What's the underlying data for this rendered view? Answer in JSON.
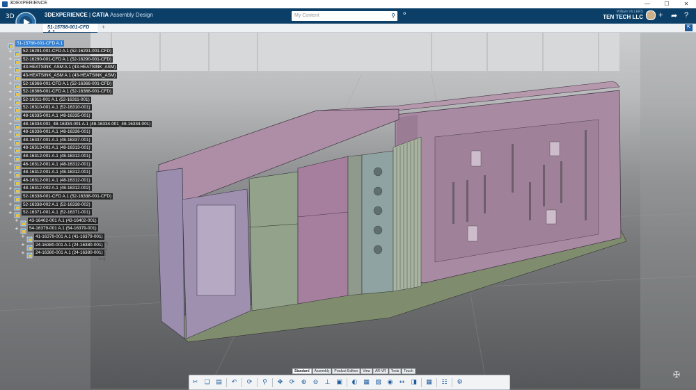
{
  "window": {
    "title": "3DEXPERIENCE",
    "controls": [
      "—",
      "☐",
      "✕"
    ]
  },
  "header": {
    "brand_bold": "3DEXPERIENCE",
    "brand_sep": " | ",
    "brand_app": "CATIA",
    "brand_module": " Assembly Design",
    "search_placeholder": "My Content",
    "user_name": "William VILLERS",
    "org": "TEN TECH LLC ⌄"
  },
  "tab": {
    "label": "51-15788-001-CFD A.1",
    "add_label": "+"
  },
  "tree": [
    {
      "label": "51-15788-001-CFD A.1",
      "level": 0,
      "selected": true
    },
    {
      "label": "52-16291-001-CFD A.1 (52-16291-001-CFD)",
      "level": 1
    },
    {
      "label": "52-16290-001-CFD A.1 (52-16290-001-CFD)",
      "level": 1
    },
    {
      "label": "43-HEATSINK_ASM A.1 (43-HEATSINK_ASM)",
      "level": 1
    },
    {
      "label": "43-HEATSINK_ASM A.1 (43-HEATSINK_ASM)",
      "level": 1
    },
    {
      "label": "52-16366-001-CFD A.1 (52-16366-001-CFD)",
      "level": 1
    },
    {
      "label": "52-16366-001-CFD A.1 (52-16366-001-CFD)",
      "level": 1
    },
    {
      "label": "52-16311-001 A.1 (52-16311-001)",
      "level": 1
    },
    {
      "label": "52-16310-001 A.1 (52-16310-001)",
      "level": 1
    },
    {
      "label": "48-16335-001 A.1 (48-16335-001)",
      "level": 1
    },
    {
      "label": "48-16334-001_48-16334-001 A.1 (48-16334-001_48-16334-001)",
      "level": 1
    },
    {
      "label": "48-16336-001 A.1 (48-16336-001)",
      "level": 1
    },
    {
      "label": "48-16337-001 A.1 (48-16337-001)",
      "level": 1
    },
    {
      "label": "48-16313-001 A.1 (48-16313-001)",
      "level": 1
    },
    {
      "label": "48-16312-001 A.1 (48-16312-001)",
      "level": 1
    },
    {
      "label": "48-16312-001 A.1 (48-16312-001)",
      "level": 1
    },
    {
      "label": "48-16312-001 A.1 (48-16312-001)",
      "level": 1
    },
    {
      "label": "48-16312-001 A.1 (48-16312-001)",
      "level": 1
    },
    {
      "label": "48-16312-002 A.1 (48-16312-002)",
      "level": 1
    },
    {
      "label": "52-16338-001-CFD A.1 (52-16338-001-CFD)",
      "level": 1
    },
    {
      "label": "52-16338-002 A.1 (52-16338-002)",
      "level": 1
    },
    {
      "label": "52-16371-001 A.1 (52-16371-001)",
      "level": 1
    },
    {
      "label": "43-16402-001 A.1 (43-16402-001)",
      "level": 2
    },
    {
      "label": "54-16379-001 A.1 (54-16379-001)",
      "level": 2
    },
    {
      "label": "41-16379-001 A.1 (41-16379-001)",
      "level": 3
    },
    {
      "label": "24-16380-001 A.1 (24-16380-001)",
      "level": 3
    },
    {
      "label": "24-16380-001 A.1 (24-16380-001)",
      "level": 3
    }
  ],
  "action_tabs": [
    "Standard",
    "Assembly",
    "Product Edition",
    "View",
    "AR-VR",
    "Tools",
    "Touch"
  ],
  "active_action_tab": "Standard",
  "toolbar_icons": [
    "scissors-icon",
    "copy-icon",
    "paste-icon",
    "undo-icon",
    "update-icon",
    "search-icon",
    "pan-icon",
    "rotate-icon",
    "zoom-icon",
    "normal-view-icon",
    "render-style-icon",
    "hide-show-icon",
    "view-mode-icon",
    "capture-icon",
    "camera-icon",
    "measure-icon",
    "section-icon",
    "grid-icon",
    "tree-reorder-icon",
    "settings-icon"
  ],
  "colors": {
    "topbar": "#0b3f68",
    "selection": "#2f7fd4",
    "part_purple": "#a787a0",
    "part_green": "#97a78f",
    "part_teal": "#8fa8a4"
  }
}
